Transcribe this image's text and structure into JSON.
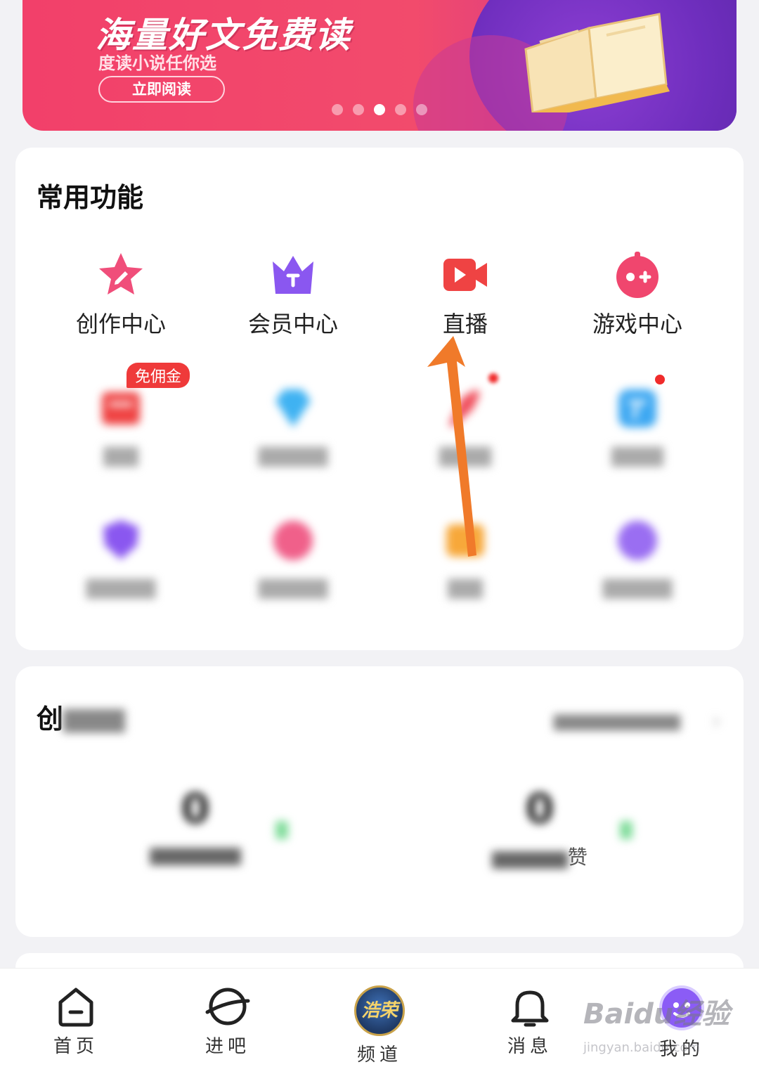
{
  "banner": {
    "title": "海量好文免费读",
    "subtitle": "度读小说任你选",
    "button": "立即阅读",
    "dots": 5,
    "active_dot": 3
  },
  "common": {
    "title": "常用功能",
    "row1": [
      {
        "label": "创作中心",
        "icon": "star-pen-icon",
        "color": "#f04e7a"
      },
      {
        "label": "会员中心",
        "icon": "crown-icon",
        "color": "#8a57f0"
      },
      {
        "label": "直播",
        "icon": "video-camera-icon",
        "color": "#ef4343"
      },
      {
        "label": "游戏中心",
        "icon": "game-controller-icon",
        "color": "#f0466e"
      }
    ],
    "row2_badge": "免佣金",
    "row2": [
      {
        "label": "",
        "icon": "shop-icon",
        "color": "#ef4343"
      },
      {
        "label": "",
        "icon": "diamond-icon",
        "color": "#3fb2f2"
      },
      {
        "label": "",
        "icon": "rocket-icon",
        "color": "#f04e5c"
      },
      {
        "label": "",
        "icon": "task-icon",
        "color": "#3da8f2"
      }
    ],
    "row3": [
      {
        "label": "",
        "icon": "shield-icon",
        "color": "#8a57f0"
      },
      {
        "label": "",
        "icon": "gift-icon",
        "color": "#f0608a"
      },
      {
        "label": "",
        "icon": "card-icon",
        "color": "#f7a83a"
      },
      {
        "label": "",
        "icon": "circle-icon",
        "color": "#9a6ef2"
      }
    ]
  },
  "creation": {
    "title": "创",
    "right_text": "",
    "stats": [
      {
        "value": "0",
        "caption": ""
      },
      {
        "value": "0",
        "caption": "赞"
      }
    ]
  },
  "nav": [
    {
      "label": "首页",
      "icon": "home-icon"
    },
    {
      "label": "进吧",
      "icon": "planet-icon"
    },
    {
      "label": "频道",
      "icon": "channel-icon",
      "badge_text": "浩荣"
    },
    {
      "label": "消息",
      "icon": "bell-icon"
    },
    {
      "label": "我的",
      "icon": "avatar-icon"
    }
  ],
  "watermark": {
    "logo": "Baidu经验",
    "url": "jingyan.baidu.com"
  },
  "colors": {
    "arrow": "#f07a2a",
    "accent": "#f04e7a"
  }
}
